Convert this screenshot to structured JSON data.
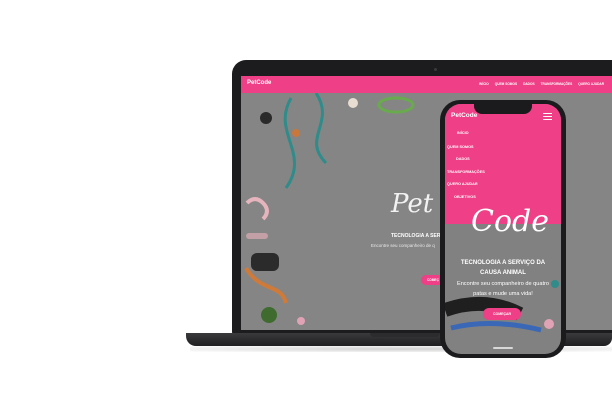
{
  "laptop": {
    "brand": "PetCode",
    "nav_links": [
      "INÍCIO",
      "QUEM SOMOS",
      "DADOS",
      "TRANSFORMAÇÕES",
      "QUERO AJUDAR"
    ],
    "hero_title": "Pet C",
    "hero_tagline": "TECNOLOGIA A SERVIÇ",
    "hero_subtitle": "Encontre seu companheiro de q",
    "cta_label": "COMEÇ"
  },
  "phone": {
    "brand": "PetCode",
    "menu_items": [
      "INÍCIO",
      "QUEM SOMOS",
      "DADOS",
      "TRANSFORMAÇÕES",
      "QUERO AJUDAR",
      "OBJETIVOS"
    ],
    "hero_title": "Code",
    "hero_tagline": "TECNOLOGIA A SERVIÇO DA CAUSA ANIMAL",
    "hero_subtitle": "Encontre seu companheiro de quatro patas e mude uma vida!",
    "cta_label": "COMEÇAR"
  },
  "colors": {
    "brand_pink": "#ef3f86",
    "device_frame": "#1b1b1d",
    "hero_overlay": "#858585"
  }
}
